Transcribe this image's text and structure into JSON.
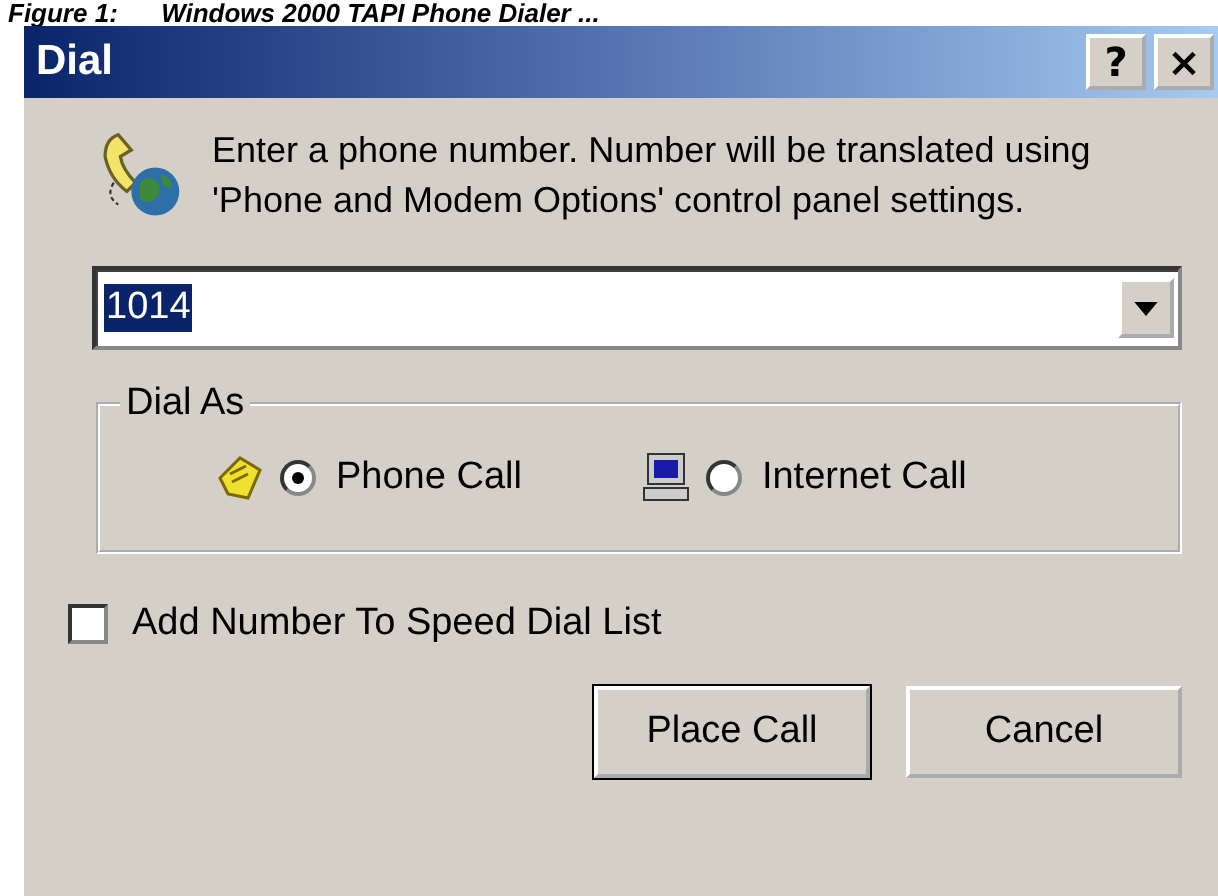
{
  "caption": "Figure 1:      Windows 2000 TAPI Phone Dialer ...",
  "window": {
    "title": "Dial",
    "title_buttons": [
      "?",
      "×"
    ]
  },
  "instructions": "Enter a phone number.  Number will be translated using 'Phone and Modem Options' control panel settings.",
  "number_field": {
    "value": "1014",
    "selected_text": true
  },
  "dial_as": {
    "legend": "Dial As",
    "options": [
      {
        "kind": "phone",
        "label": "Phone Call",
        "selected": true
      },
      {
        "kind": "computer",
        "label": "Internet Call",
        "selected": false
      }
    ]
  },
  "speed_dial": {
    "label": "Add Number To Speed Dial List",
    "checked": false
  },
  "buttons": [
    {
      "label": "Place Call",
      "default": true
    },
    {
      "label": "Cancel",
      "default": false
    }
  ]
}
